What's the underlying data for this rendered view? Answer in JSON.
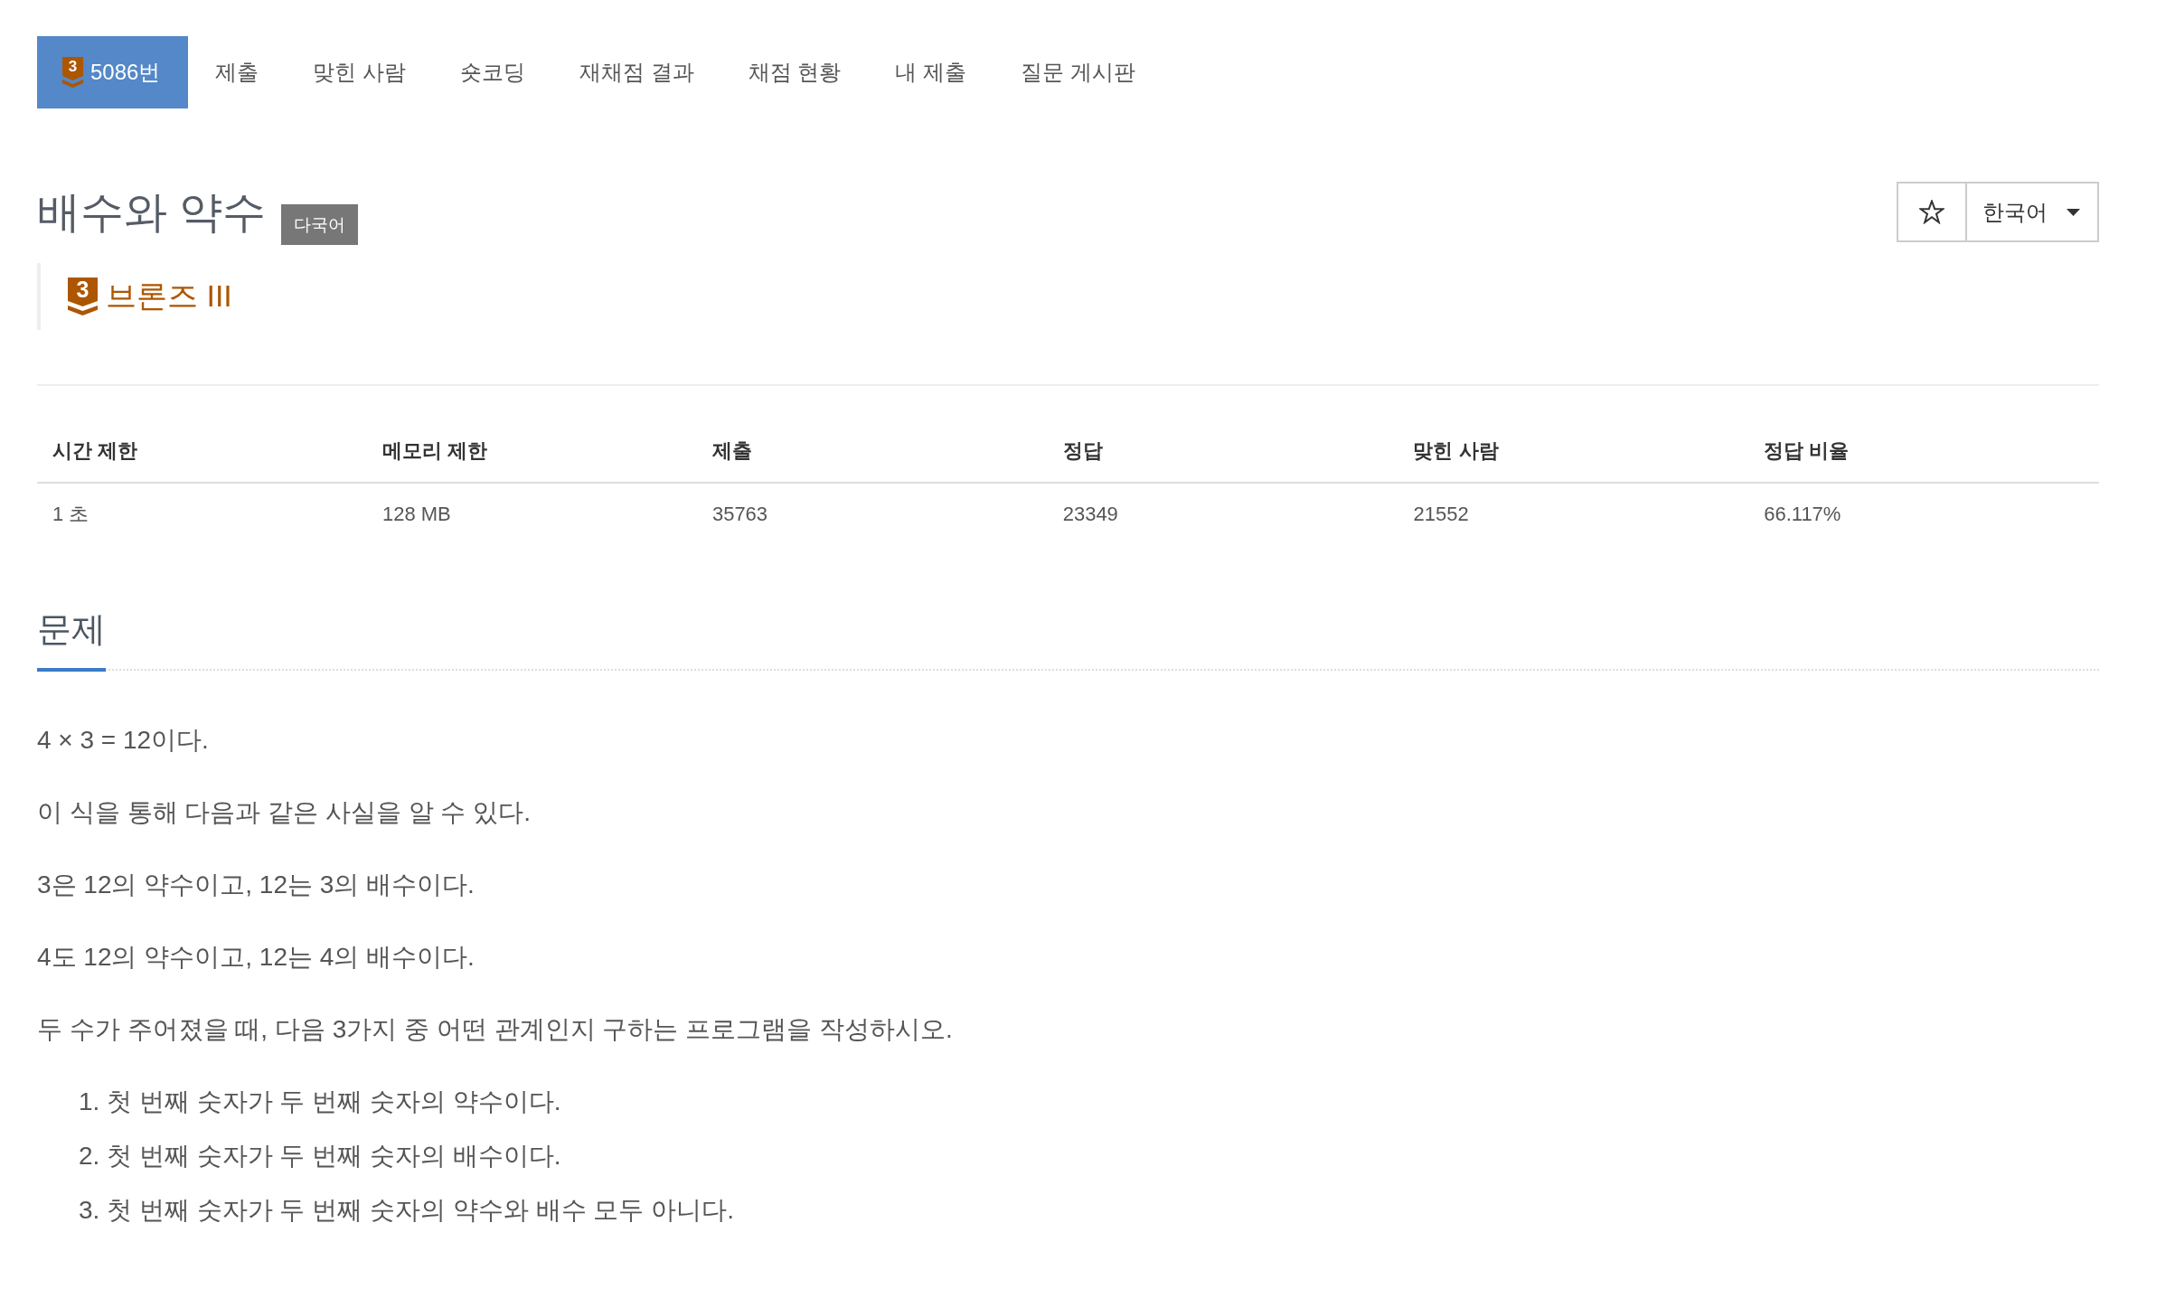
{
  "nav": {
    "tabs": [
      {
        "label": "5086번",
        "badge": "3",
        "selected": true
      },
      {
        "label": "제출",
        "selected": false
      },
      {
        "label": "맞힌 사람",
        "selected": false
      },
      {
        "label": "숏코딩",
        "selected": false
      },
      {
        "label": "재채점 결과",
        "selected": false
      },
      {
        "label": "채점 현황",
        "selected": false
      },
      {
        "label": "내 제출",
        "selected": false
      },
      {
        "label": "질문 게시판",
        "selected": false
      }
    ]
  },
  "problem": {
    "title": "배수와 약수",
    "tag": "다국어",
    "tier": {
      "badge": "3",
      "label": "브론즈 III"
    }
  },
  "toolbar": {
    "language": "한국어"
  },
  "limits_table": {
    "columns": [
      "시간 제한",
      "메모리 제한",
      "제출",
      "정답",
      "맞힌 사람",
      "정답 비율"
    ],
    "rows": [
      [
        "1 초",
        "128 MB",
        "35763",
        "23349",
        "21552",
        "66.117%"
      ]
    ]
  },
  "section": {
    "heading": "문제",
    "paragraphs": [
      "4 × 3 = 12이다.",
      "이 식을 통해 다음과 같은 사실을 알 수 있다.",
      "3은 12의 약수이고, 12는 3의 배수이다.",
      "4도 12의 약수이고, 12는 4의 배수이다.",
      "두 수가 주어졌을 때, 다음 3가지 중 어떤 관계인지 구하는 프로그램을 작성하시오."
    ],
    "list": [
      "1. 첫 번째 숫자가 두 번째 숫자의 약수이다.",
      "2. 첫 번째 숫자가 두 번째 숫자의 배수이다.",
      "3. 첫 번째 숫자가 두 번째 숫자의 약수와 배수 모두 아니다."
    ]
  }
}
